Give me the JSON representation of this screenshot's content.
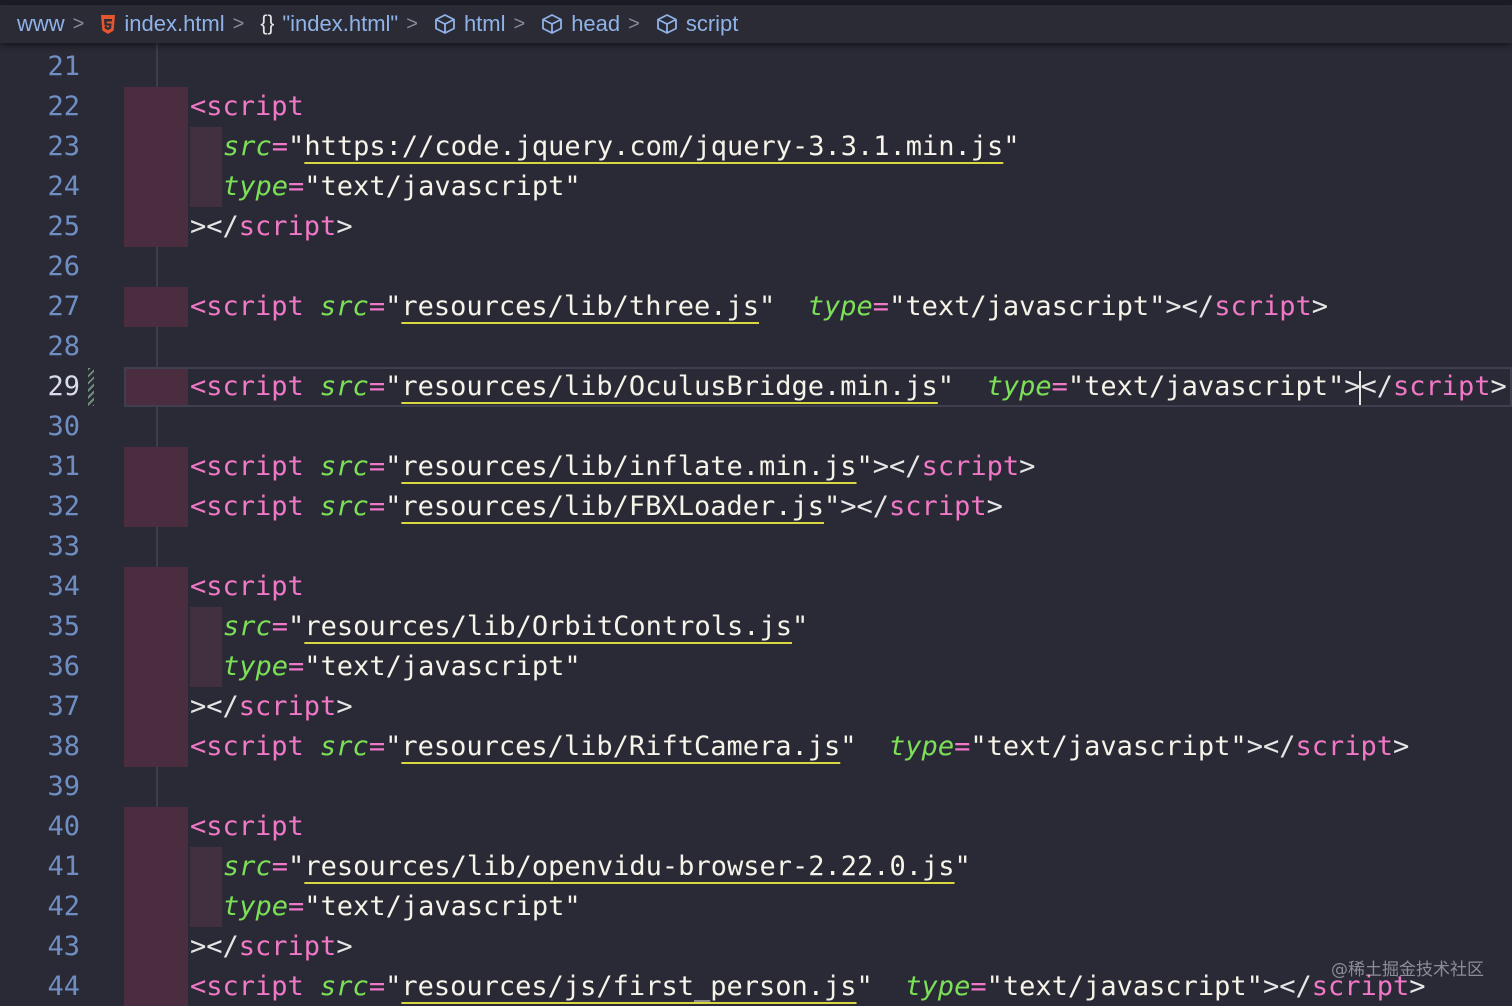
{
  "breadcrumb": [
    {
      "label": "www",
      "icon": "none"
    },
    {
      "label": "index.html",
      "icon": "html5-icon"
    },
    {
      "label": "\"index.html\"",
      "icon": "braces-icon"
    },
    {
      "label": "html",
      "icon": "cube-icon"
    },
    {
      "label": "head",
      "icon": "cube-icon"
    },
    {
      "label": "script",
      "icon": "cube-icon"
    }
  ],
  "separator": ">",
  "braces_glyph": "{}",
  "active_line": 29,
  "lines": [
    {
      "n": 21,
      "tokens": []
    },
    {
      "n": 22,
      "tokens": [
        [
          "tag",
          "<script"
        ]
      ]
    },
    {
      "n": 23,
      "indent": true,
      "tokens": [
        [
          "attr",
          "src"
        ],
        [
          "eq",
          "="
        ],
        [
          "str",
          "\""
        ],
        [
          "link",
          "https://code.jquery.com/jquery-3.3.1.min.js"
        ],
        [
          "str",
          "\""
        ]
      ]
    },
    {
      "n": 24,
      "indent": true,
      "tokens": [
        [
          "attr",
          "type"
        ],
        [
          "eq",
          "="
        ],
        [
          "str",
          "\"text/javascript\""
        ]
      ]
    },
    {
      "n": 25,
      "tokens": [
        [
          "punc",
          ">"
        ],
        [
          "punc",
          "</"
        ],
        [
          "tag",
          "script"
        ],
        [
          "punc",
          ">"
        ]
      ]
    },
    {
      "n": 26,
      "tokens": []
    },
    {
      "n": 27,
      "tokens": [
        [
          "tag",
          "<script "
        ],
        [
          "attr",
          "src"
        ],
        [
          "eq",
          "="
        ],
        [
          "str",
          "\""
        ],
        [
          "link",
          "resources/lib/three.js"
        ],
        [
          "str",
          "\"  "
        ],
        [
          "attr",
          "type"
        ],
        [
          "eq",
          "="
        ],
        [
          "str",
          "\"text/javascript\""
        ],
        [
          "punc",
          ">"
        ],
        [
          "punc",
          "</"
        ],
        [
          "tag",
          "script"
        ],
        [
          "punc",
          ">"
        ]
      ]
    },
    {
      "n": 28,
      "tokens": []
    },
    {
      "n": 29,
      "tokens": [
        [
          "tag",
          "<script "
        ],
        [
          "attr",
          "src"
        ],
        [
          "eq",
          "="
        ],
        [
          "str",
          "\""
        ],
        [
          "link",
          "resources/lib/OculusBridge.min.js"
        ],
        [
          "str",
          "\"  "
        ],
        [
          "attr",
          "type"
        ],
        [
          "eq",
          "="
        ],
        [
          "str",
          "\"text/javascript\""
        ],
        [
          "punc",
          ">"
        ],
        [
          "caret",
          ""
        ],
        [
          "punc",
          "</"
        ],
        [
          "tag",
          "script"
        ],
        [
          "punc",
          ">"
        ]
      ]
    },
    {
      "n": 30,
      "tokens": []
    },
    {
      "n": 31,
      "tokens": [
        [
          "tag",
          "<script "
        ],
        [
          "attr",
          "src"
        ],
        [
          "eq",
          "="
        ],
        [
          "str",
          "\""
        ],
        [
          "link",
          "resources/lib/inflate.min.js"
        ],
        [
          "str",
          "\""
        ],
        [
          "punc",
          ">"
        ],
        [
          "punc",
          "</"
        ],
        [
          "tag",
          "script"
        ],
        [
          "punc",
          ">"
        ]
      ]
    },
    {
      "n": 32,
      "tokens": [
        [
          "tag",
          "<script "
        ],
        [
          "attr",
          "src"
        ],
        [
          "eq",
          "="
        ],
        [
          "str",
          "\""
        ],
        [
          "link",
          "resources/lib/FBXLoader.js"
        ],
        [
          "str",
          "\""
        ],
        [
          "punc",
          ">"
        ],
        [
          "punc",
          "</"
        ],
        [
          "tag",
          "script"
        ],
        [
          "punc",
          ">"
        ]
      ]
    },
    {
      "n": 33,
      "tokens": []
    },
    {
      "n": 34,
      "tokens": [
        [
          "tag",
          "<script"
        ]
      ]
    },
    {
      "n": 35,
      "indent": true,
      "tokens": [
        [
          "attr",
          "src"
        ],
        [
          "eq",
          "="
        ],
        [
          "str",
          "\""
        ],
        [
          "link",
          "resources/lib/OrbitControls.js"
        ],
        [
          "str",
          "\""
        ]
      ]
    },
    {
      "n": 36,
      "indent": true,
      "tokens": [
        [
          "attr",
          "type"
        ],
        [
          "eq",
          "="
        ],
        [
          "str",
          "\"text/javascript\""
        ]
      ]
    },
    {
      "n": 37,
      "tokens": [
        [
          "punc",
          ">"
        ],
        [
          "punc",
          "</"
        ],
        [
          "tag",
          "script"
        ],
        [
          "punc",
          ">"
        ]
      ]
    },
    {
      "n": 38,
      "tokens": [
        [
          "tag",
          "<script "
        ],
        [
          "attr",
          "src"
        ],
        [
          "eq",
          "="
        ],
        [
          "str",
          "\""
        ],
        [
          "link",
          "resources/lib/RiftCamera.js"
        ],
        [
          "str",
          "\"  "
        ],
        [
          "attr",
          "type"
        ],
        [
          "eq",
          "="
        ],
        [
          "str",
          "\"text/javascript\""
        ],
        [
          "punc",
          ">"
        ],
        [
          "punc",
          "</"
        ],
        [
          "tag",
          "script"
        ],
        [
          "punc",
          ">"
        ]
      ]
    },
    {
      "n": 39,
      "tokens": []
    },
    {
      "n": 40,
      "tokens": [
        [
          "tag",
          "<script"
        ]
      ]
    },
    {
      "n": 41,
      "indent": true,
      "tokens": [
        [
          "attr",
          "src"
        ],
        [
          "eq",
          "="
        ],
        [
          "str",
          "\""
        ],
        [
          "link",
          "resources/lib/openvidu-browser-2.22.0.js"
        ],
        [
          "str",
          "\""
        ]
      ]
    },
    {
      "n": 42,
      "indent": true,
      "tokens": [
        [
          "attr",
          "type"
        ],
        [
          "eq",
          "="
        ],
        [
          "str",
          "\"text/javascript\""
        ]
      ]
    },
    {
      "n": 43,
      "tokens": [
        [
          "punc",
          ">"
        ],
        [
          "punc",
          "</"
        ],
        [
          "tag",
          "script"
        ],
        [
          "punc",
          ">"
        ]
      ]
    },
    {
      "n": 44,
      "tokens": [
        [
          "tag",
          "<script "
        ],
        [
          "attr",
          "src"
        ],
        [
          "eq",
          "="
        ],
        [
          "str",
          "\""
        ],
        [
          "link",
          "resources/js/first_person.js"
        ],
        [
          "str",
          "\"  "
        ],
        [
          "attr",
          "type"
        ],
        [
          "eq",
          "="
        ],
        [
          "str",
          "\"text/javascript\""
        ],
        [
          "punc",
          ">"
        ],
        [
          "punc",
          "</"
        ],
        [
          "tag",
          "script"
        ],
        [
          "punc",
          ">"
        ]
      ]
    }
  ],
  "watermark": "@稀土掘金技术社区",
  "colors": {
    "background": "#2a2a36",
    "tag": "#f078c6",
    "attribute": "#7be058",
    "string": "#f6f4e8",
    "link_underline": "#d9d63f",
    "line_number": "#6f8fc4",
    "breadcrumb_text": "#8fb3e8",
    "diff_marker": "#4a2e40"
  }
}
